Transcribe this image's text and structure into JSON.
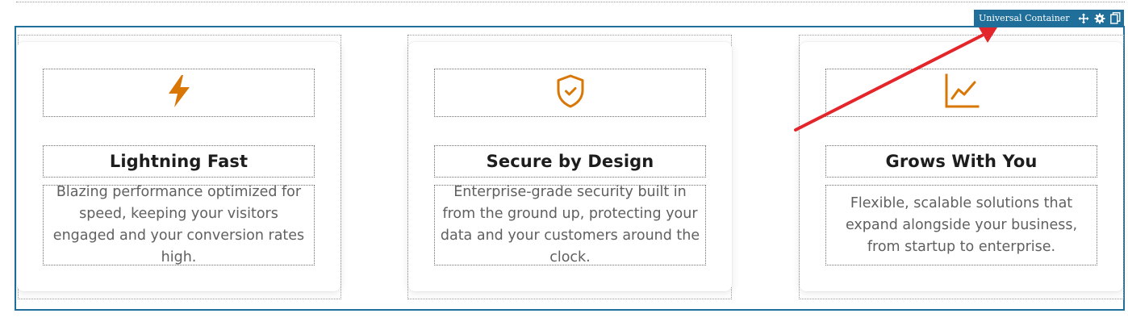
{
  "toolbar": {
    "label": "Universal Container",
    "icons": [
      "move-icon",
      "gear-icon",
      "copy-icon",
      "trash-icon"
    ]
  },
  "colors": {
    "accent": "#d97706",
    "container_border": "#1f6f9a",
    "annotation_arrow": "#e3262b"
  },
  "cards": [
    {
      "icon": "lightning-icon",
      "title": "Lightning Fast",
      "description": "Blazing performance optimized for speed, keeping your visitors engaged and your conversion rates high."
    },
    {
      "icon": "shield-check-icon",
      "title": "Secure by Design",
      "description": "Enterprise-grade security built in from the ground up, protecting your data and your customers around the clock."
    },
    {
      "icon": "line-chart-icon",
      "title": "Grows With You",
      "description": "Flexible, scalable solutions that expand alongside your business, from startup to enterprise."
    }
  ]
}
